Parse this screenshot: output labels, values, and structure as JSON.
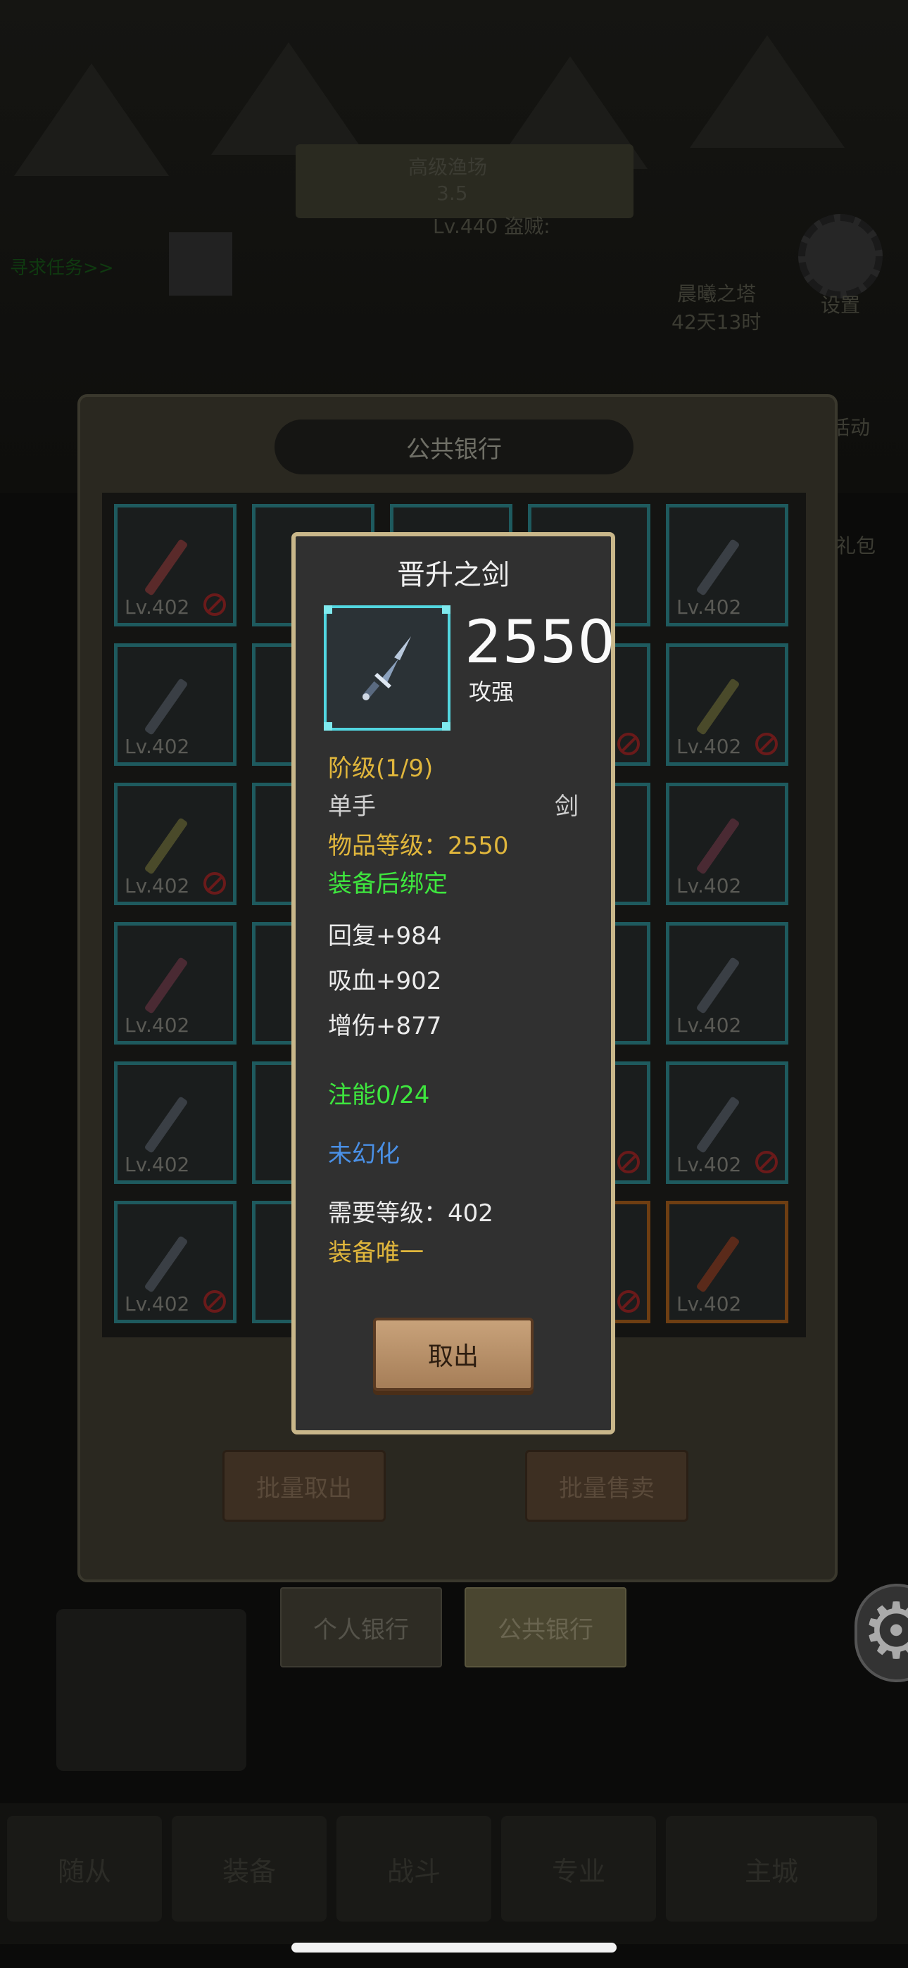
{
  "background": {
    "banner_line1": "高级渔场",
    "banner_line2": "3.5",
    "banner_line3": "Lv.440 盗贼:",
    "quest_link": "寻求任务>>",
    "settings_label": "设置",
    "event_label": "活动",
    "pack_label": "礼包",
    "tower_label": "晨曦之塔",
    "tower_time": "42天13时"
  },
  "bank_panel": {
    "title": "公共银行",
    "batch_take_label": "批量取出",
    "batch_sell_label": "批量售卖",
    "tabs": [
      {
        "label": "个人银行"
      },
      {
        "label": "公共银行"
      }
    ],
    "slot_level": "Lv.402"
  },
  "bottom_nav": {
    "tabs": [
      {
        "label": "随从"
      },
      {
        "label": "装备"
      },
      {
        "label": "战斗"
      },
      {
        "label": "专业"
      },
      {
        "label": "主城"
      }
    ]
  },
  "item_dialog": {
    "name": "晋升之剑",
    "power": "2550",
    "power_label": "攻强",
    "tier": "阶级(1/9)",
    "hand_type": "单手",
    "weapon_type": "剑",
    "item_level": "物品等级：2550",
    "bind": "装备后绑定",
    "stats": [
      {
        "text": "回复+984"
      },
      {
        "text": "吸血+902"
      },
      {
        "text": "增伤+877"
      }
    ],
    "infuse": "注能0/24",
    "illusion": "未幻化",
    "required_level": "需要等级：402",
    "unique": "装备唯一",
    "take_out_label": "取出"
  },
  "colors": {
    "dialog_border": "#c9b78a",
    "frame_cyan": "#52d6e0",
    "yellow_text": "#e0b63c",
    "green_text": "#3ee63e",
    "blue_text": "#4a90e6"
  }
}
